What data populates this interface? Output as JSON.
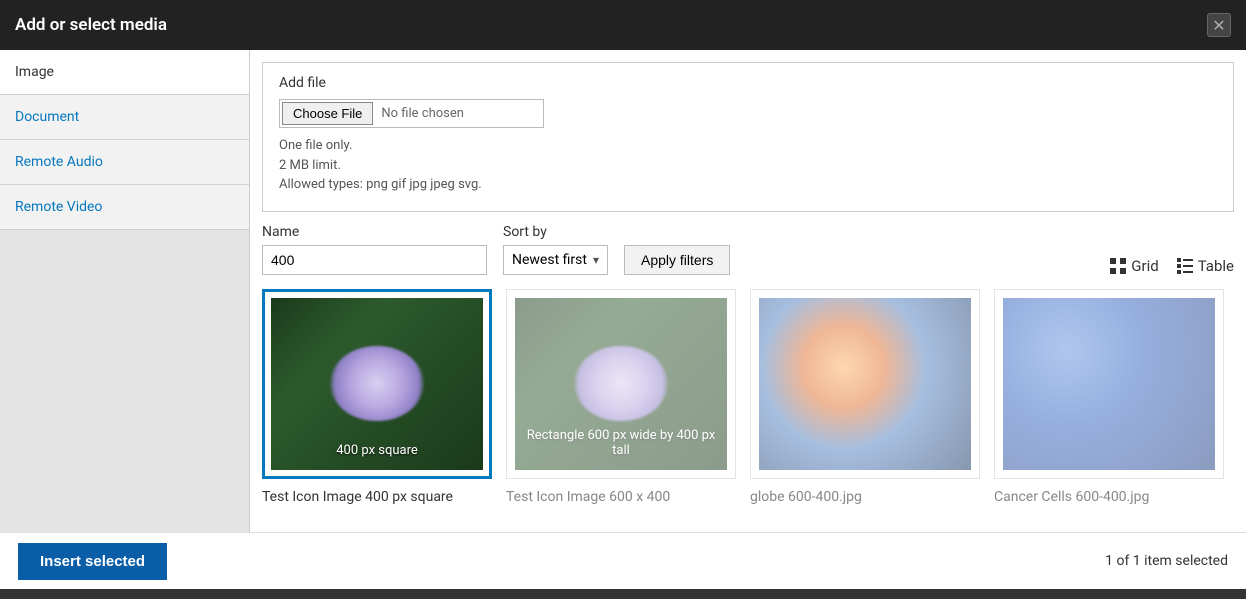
{
  "header": {
    "title": "Add or select media"
  },
  "sidebar": {
    "items": [
      {
        "label": "Image",
        "active": true
      },
      {
        "label": "Document",
        "active": false
      },
      {
        "label": "Remote Audio",
        "active": false
      },
      {
        "label": "Remote Video",
        "active": false
      }
    ]
  },
  "addFile": {
    "label": "Add file",
    "chooseButton": "Choose File",
    "noFileText": "No file chosen",
    "constraint1": "One file only.",
    "constraint2": "2 MB limit.",
    "constraint3": "Allowed types: png gif jpg jpeg svg."
  },
  "filters": {
    "nameLabel": "Name",
    "nameValue": "400",
    "sortLabel": "Sort by",
    "sortValue": "Newest first",
    "applyLabel": "Apply filters",
    "gridLabel": "Grid",
    "tableLabel": "Table"
  },
  "media": [
    {
      "title": "Test Icon Image 400 px square",
      "overlay": "400 px square",
      "selected": true,
      "kind": "flower"
    },
    {
      "title": "Test Icon Image 600 x 400",
      "overlay": "Rectangle 600 px wide  by 400 px tall",
      "selected": false,
      "kind": "flower"
    },
    {
      "title": "globe 600-400.jpg",
      "overlay": "",
      "selected": false,
      "kind": "globe"
    },
    {
      "title": "Cancer Cells 600-400.jpg",
      "overlay": "",
      "selected": false,
      "kind": "cells"
    }
  ],
  "footer": {
    "insertLabel": "Insert selected",
    "selectionText": "1 of 1 item selected"
  }
}
